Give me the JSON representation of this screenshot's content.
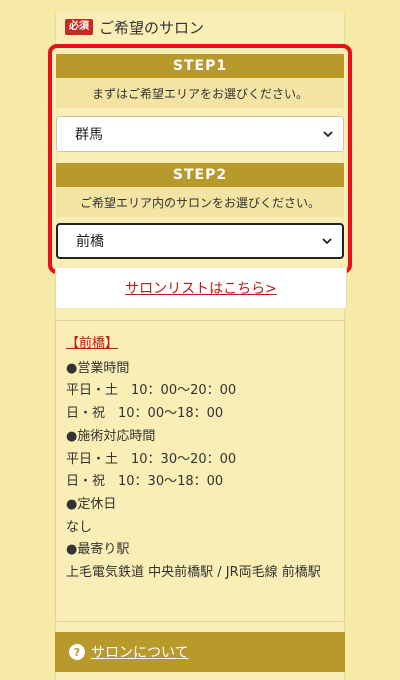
{
  "section": {
    "required_badge": "必須",
    "title": "ご希望のサロン"
  },
  "step1": {
    "label": "STEP1",
    "note": "まずはご希望エリアをお選びください。",
    "selected": "群馬"
  },
  "step2": {
    "label": "STEP2",
    "note": "ご希望エリア内のサロンをお選びください。",
    "selected": "前橋"
  },
  "salon_list_link": "サロンリストはこちら>",
  "info": {
    "name": "【前橋】",
    "lines": [
      "●営業時間",
      "平日・土　10：00〜20：00",
      "日・祝　10：00〜18：00",
      "●施術対応時間",
      "平日・土　10：30〜20：00",
      "日・祝　10：30〜18：00",
      "●定休日",
      "なし",
      "●最寄り駅",
      "上毛電気鉄道 中央前橋駅 / JR両毛線 前橋駅"
    ]
  },
  "about": {
    "icon": "question-icon",
    "label": "サロンについて"
  },
  "colors": {
    "accent": "#b89a2c",
    "frame": "#e8101a",
    "link": "#b3201a",
    "background": "#f7e9a6"
  }
}
